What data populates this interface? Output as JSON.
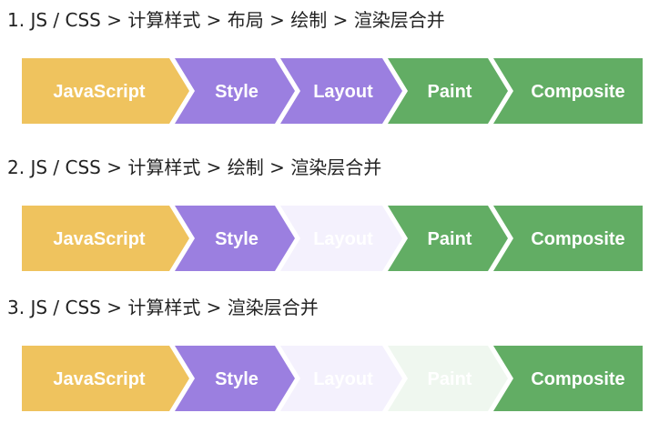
{
  "colors": {
    "javascript": "#EFC35E",
    "style": "#9B7FE0",
    "layout": "#9B7FE0",
    "paint": "#62AD64",
    "composite": "#62AD64",
    "faded_purple": "#F4F1FD",
    "faded_green": "#EFF7EF"
  },
  "rows": [
    {
      "heading": "1. JS / CSS > 计算样式 > 布局 > 绘制 > 渲染层合并",
      "stages": [
        {
          "label": "JavaScript",
          "active": true
        },
        {
          "label": "Style",
          "active": true
        },
        {
          "label": "Layout",
          "active": true
        },
        {
          "label": "Paint",
          "active": true
        },
        {
          "label": "Composite",
          "active": true
        }
      ]
    },
    {
      "heading": "2. JS / CSS > 计算样式 > 绘制 > 渲染层合并",
      "stages": [
        {
          "label": "JavaScript",
          "active": true
        },
        {
          "label": "Style",
          "active": true
        },
        {
          "label": "Layout",
          "active": false
        },
        {
          "label": "Paint",
          "active": true
        },
        {
          "label": "Composite",
          "active": true
        }
      ]
    },
    {
      "heading": "3. JS / CSS > 计算样式 > 渲染层合并",
      "stages": [
        {
          "label": "JavaScript",
          "active": true
        },
        {
          "label": "Style",
          "active": true
        },
        {
          "label": "Layout",
          "active": false
        },
        {
          "label": "Paint",
          "active": false
        },
        {
          "label": "Composite",
          "active": true
        }
      ]
    }
  ]
}
